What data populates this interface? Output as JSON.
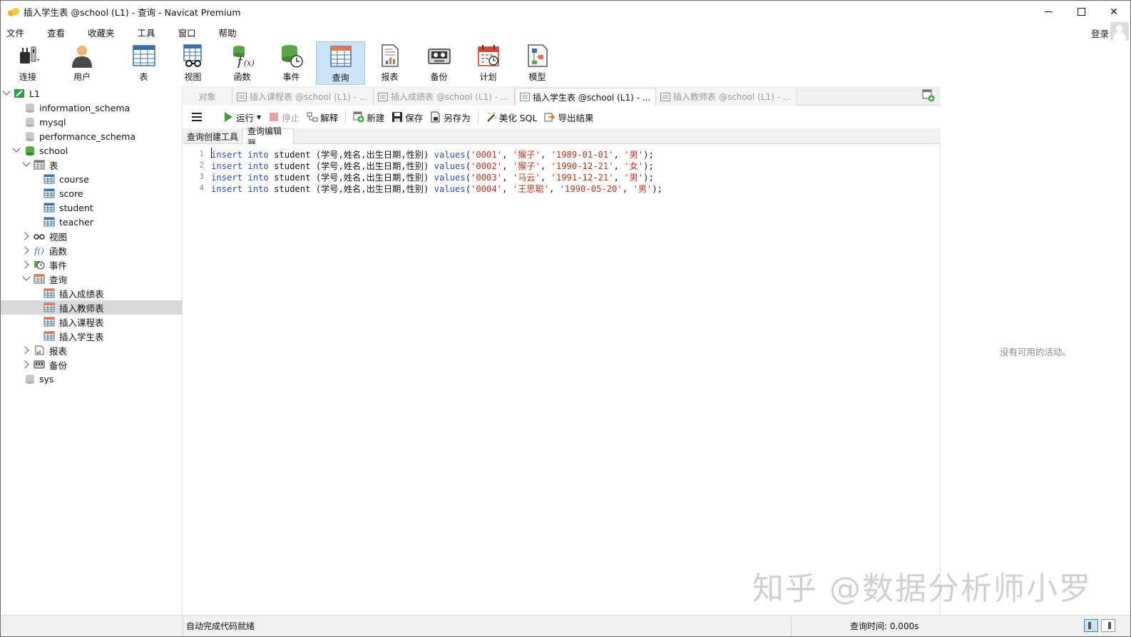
{
  "window": {
    "title": "插入学生表 @school (L1) - 查询 - Navicat Premium"
  },
  "menu": [
    "文件",
    "查看",
    "收藏夹",
    "工具",
    "窗口",
    "帮助"
  ],
  "login": "登录",
  "toolbar": [
    {
      "label": "连接",
      "icon": "plug-icon"
    },
    {
      "label": "用户",
      "icon": "user-icon"
    },
    {
      "label": "表",
      "icon": "table-icon"
    },
    {
      "label": "视图",
      "icon": "view-icon"
    },
    {
      "label": "函数",
      "icon": "function-icon"
    },
    {
      "label": "事件",
      "icon": "event-icon"
    },
    {
      "label": "查询",
      "icon": "query-icon",
      "active": true
    },
    {
      "label": "报表",
      "icon": "report-icon"
    },
    {
      "label": "备份",
      "icon": "backup-icon"
    },
    {
      "label": "计划",
      "icon": "schedule-icon"
    },
    {
      "label": "模型",
      "icon": "model-icon"
    }
  ],
  "tree": {
    "connection": "L1",
    "databases": [
      "information_schema",
      "mysql",
      "performance_schema",
      "school",
      "sys"
    ],
    "school_children": {
      "tables_label": "表",
      "tables": [
        "course",
        "score",
        "student",
        "teacher"
      ],
      "views_label": "视图",
      "functions_label": "函数",
      "events_label": "事件",
      "queries_label": "查询",
      "queries": [
        "插入成绩表",
        "插入教师表",
        "插入课程表",
        "插入学生表"
      ],
      "reports_label": "报表",
      "backups_label": "备份"
    },
    "selected": "插入教师表"
  },
  "tabs": {
    "objects": "对象",
    "items": [
      "插入课程表 @school (L1) - ...",
      "插入成绩表 @school (L1) - ...",
      "插入学生表 @school (L1) - ...",
      "插入教师表 @school (L1) - ..."
    ],
    "active_index": 2
  },
  "editor_toolbar": {
    "run": "运行",
    "stop": "停止",
    "explain": "解释",
    "new": "新建",
    "save": "保存",
    "save_as": "另存为",
    "beautify": "美化 SQL",
    "export": "导出结果"
  },
  "subtabs": [
    "查询创建工具",
    "查询编辑器"
  ],
  "sql_lines": [
    {
      "n": "1",
      "kw1": "insert",
      "kw2": "into",
      "mid": " student (学号,姓名,出生日期,性别) ",
      "fn": "values",
      "p1": "(",
      "s1": "'0001'",
      "c1": ", ",
      "s2": "'猴子'",
      "c2": ", ",
      "s3": "'1989-01-01'",
      "c3": ", ",
      "s4": "'男'",
      "end": ");"
    },
    {
      "n": "2",
      "kw1": "insert",
      "kw2": "into",
      "mid": " student (学号,姓名,出生日期,性别) ",
      "fn": "values",
      "p1": "(",
      "s1": "'0002'",
      "c1": ", ",
      "s2": "'猴子'",
      "c2": ", ",
      "s3": "'1990-12-21'",
      "c3": ", ",
      "s4": "'女'",
      "end": ");"
    },
    {
      "n": "3",
      "kw1": "insert",
      "kw2": "into",
      "mid": " student (学号,姓名,出生日期,性别) ",
      "fn": "values",
      "p1": "(",
      "s1": "'0003'",
      "c1": ", ",
      "s2": "'马云'",
      "c2": ", ",
      "s3": "'1991-12-21'",
      "c3": ", ",
      "s4": "'男'",
      "end": ");"
    },
    {
      "n": "4",
      "kw1": "insert",
      "kw2": "into",
      "mid": " student (学号,姓名,出生日期,性别) ",
      "fn": "values",
      "p1": "(",
      "s1": "'0004'",
      "c1": ", ",
      "s2": "'王思聪'",
      "c2": ", ",
      "s3": "'1990-05-20'",
      "c3": ", ",
      "s4": "'男'",
      "end": ");"
    }
  ],
  "right_panel": {
    "message": "没有可用的活动。"
  },
  "status": {
    "left": "自动完成代码就绪",
    "right": "查询时间: 0.000s"
  },
  "watermark": "知乎 @数据分析师小罗"
}
